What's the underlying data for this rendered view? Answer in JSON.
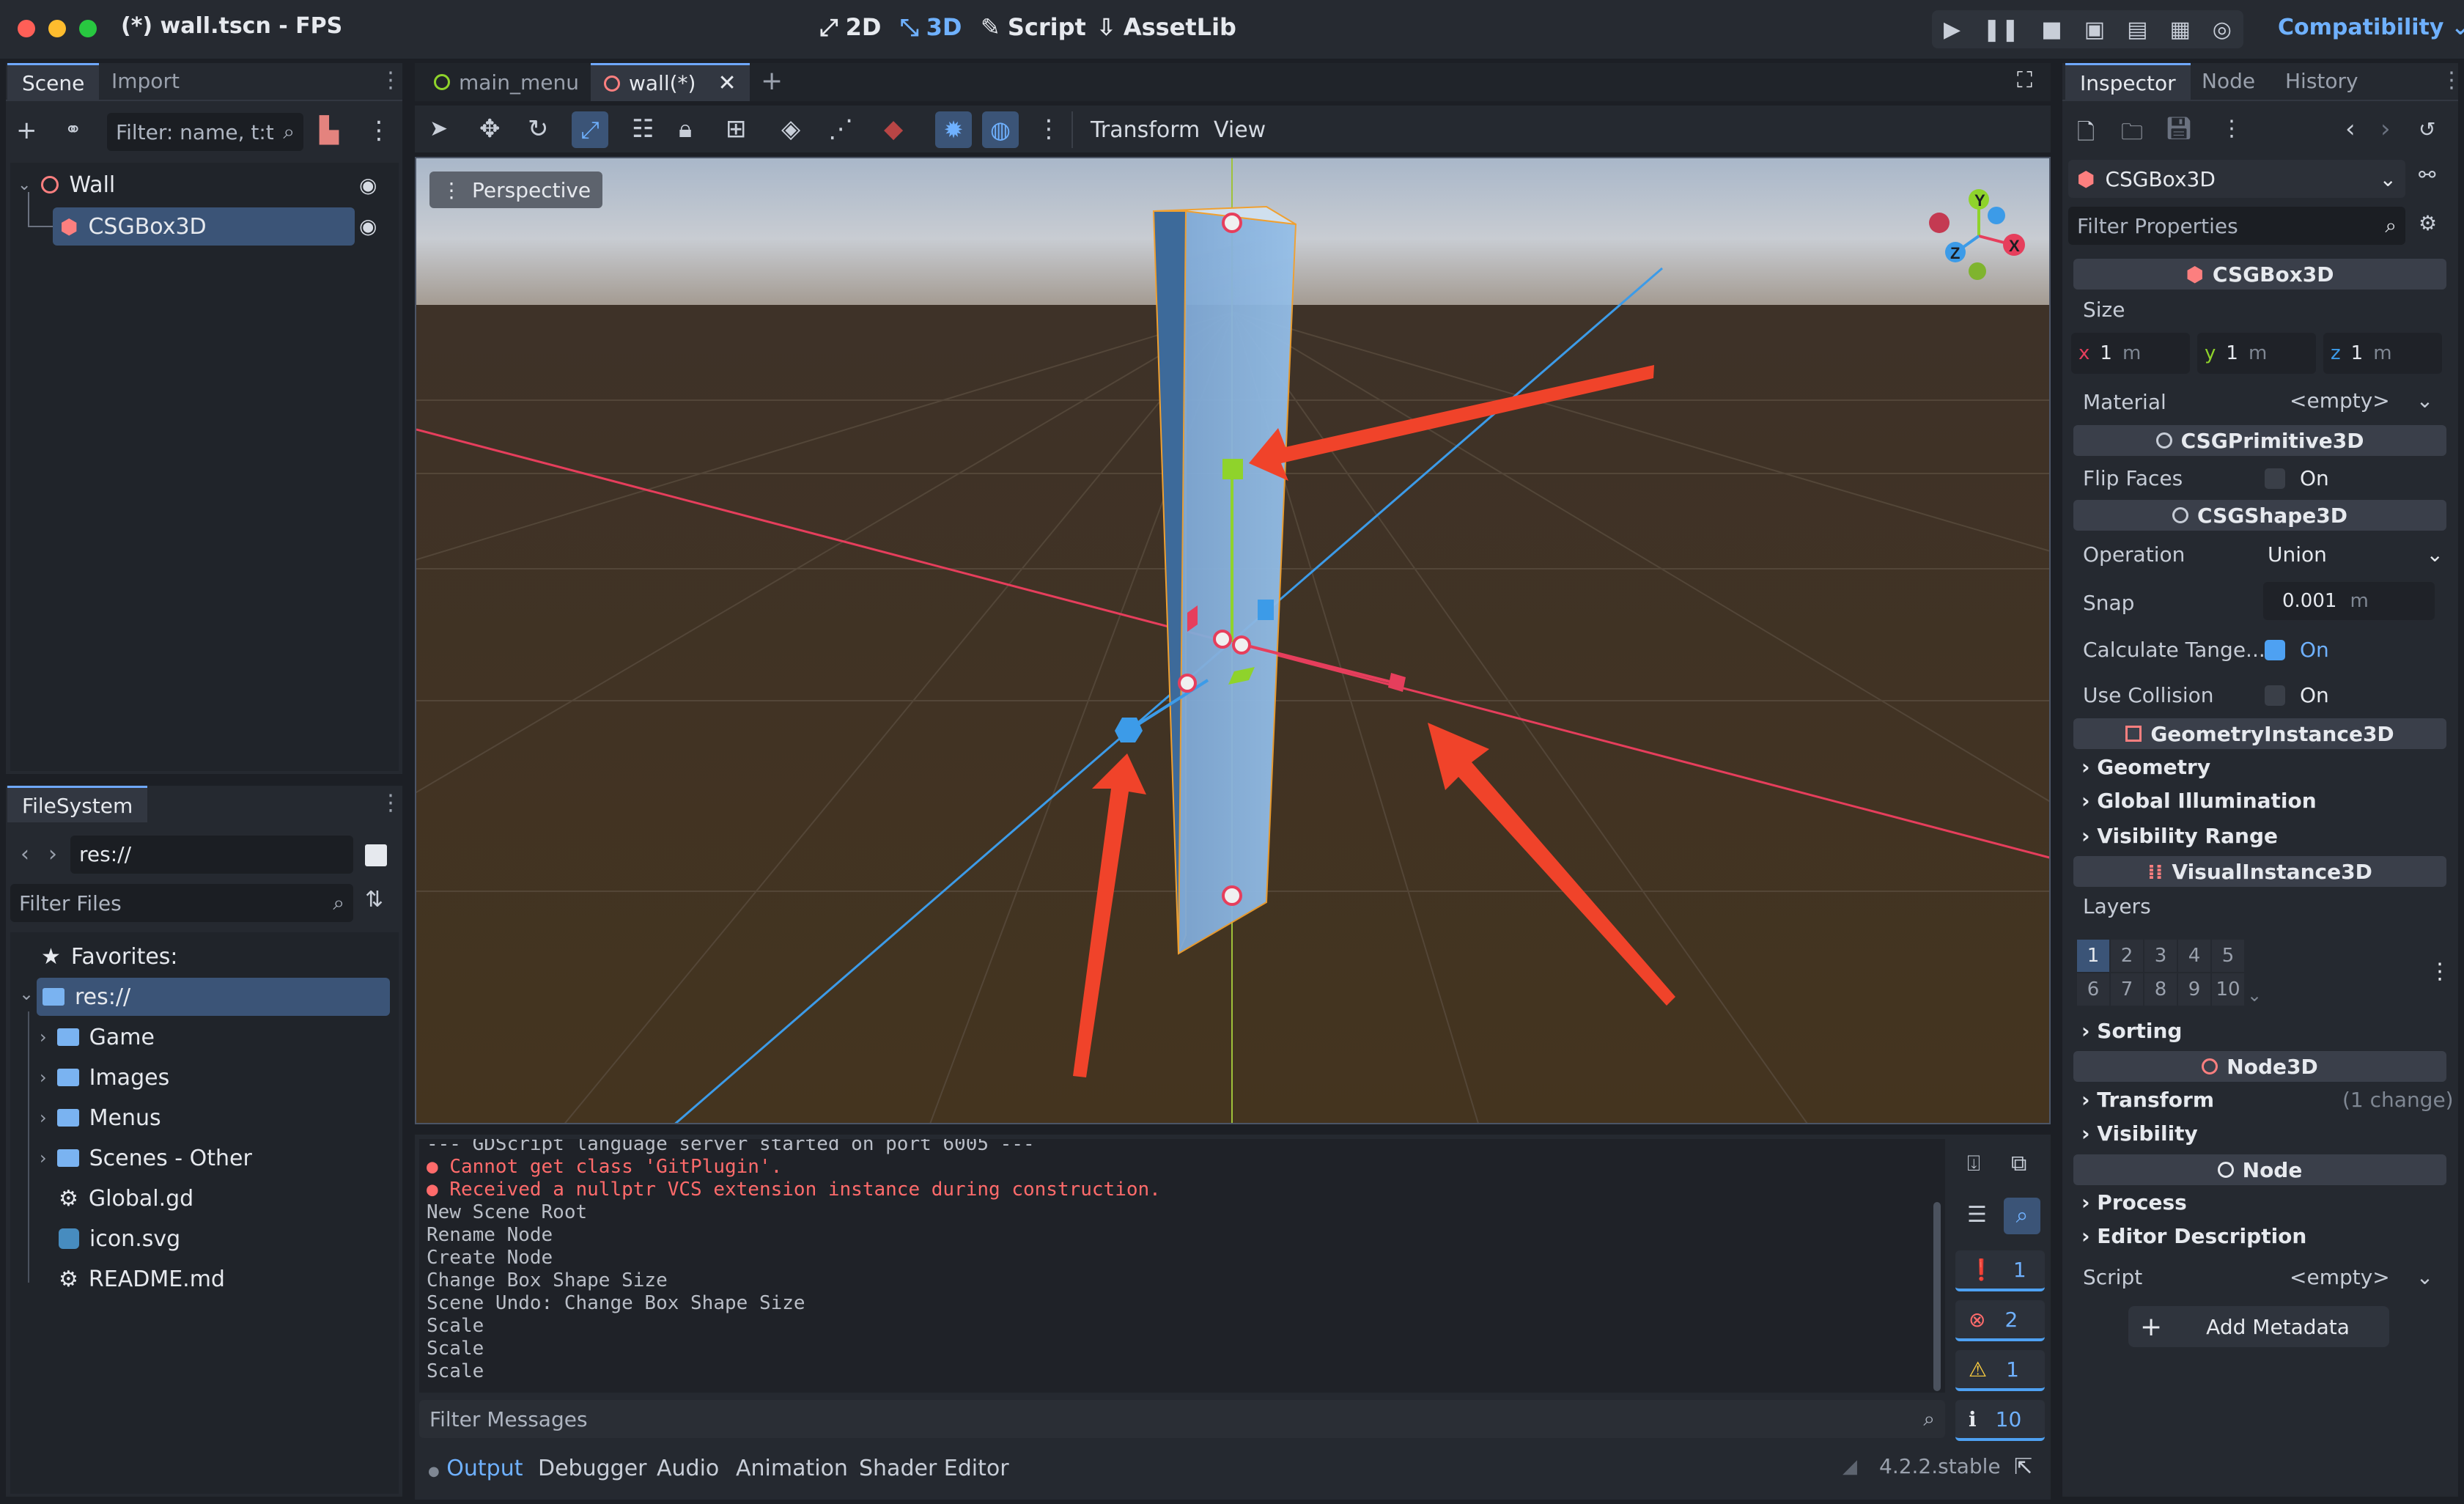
{
  "window": {
    "title": "(*) wall.tscn - FPS"
  },
  "main_modes": [
    "2D",
    "3D",
    "Script",
    "AssetLib"
  ],
  "renderer": "Compatibility",
  "scene_dock": {
    "tabs": [
      "Scene",
      "Import"
    ],
    "filter_placeholder": "Filter: name, t:t",
    "tree": [
      {
        "label": "Wall",
        "icon": "node3d-circle-icon"
      },
      {
        "label": "CSGBox3D",
        "icon": "csgbox-icon"
      }
    ]
  },
  "filesystem": {
    "tab": "FileSystem",
    "path": "res://",
    "filter_placeholder": "Filter Files",
    "items": [
      {
        "label": "Favorites:",
        "icon": "star-icon"
      },
      {
        "label": "res://",
        "icon": "folder-icon"
      },
      {
        "label": "Game",
        "icon": "folder-icon"
      },
      {
        "label": "Images",
        "icon": "folder-icon"
      },
      {
        "label": "Menus",
        "icon": "folder-icon"
      },
      {
        "label": "Scenes - Other",
        "icon": "folder-icon"
      },
      {
        "label": "Global.gd",
        "icon": "gear-icon"
      },
      {
        "label": "icon.svg",
        "icon": "image-icon"
      },
      {
        "label": "README.md",
        "icon": "gear-icon"
      }
    ]
  },
  "editor_tabs": [
    {
      "label": "main_menu",
      "active": false
    },
    {
      "label": "wall(*)",
      "active": true
    }
  ],
  "viewport_toolbar": {
    "transform": "Transform",
    "view": "View"
  },
  "viewport": {
    "perspective_label": "Perspective",
    "gizmo_axes": [
      "Y",
      "X",
      "Z"
    ]
  },
  "console": {
    "lines": [
      {
        "text": "--- GDScript language server started on port 6005 ---",
        "type": "info"
      },
      {
        "text": "Cannot get class 'GitPlugin'.",
        "type": "error"
      },
      {
        "text": "Received a nullptr VCS extension instance during construction.",
        "type": "error"
      },
      {
        "text": "New Scene Root",
        "type": "info"
      },
      {
        "text": "Rename Node",
        "type": "info"
      },
      {
        "text": "Create Node",
        "type": "info"
      },
      {
        "text": "Change Box Shape Size",
        "type": "info"
      },
      {
        "text": "Scene Undo: Change Box Shape Size",
        "type": "info"
      },
      {
        "text": "Scale",
        "type": "info"
      },
      {
        "text": "Scale",
        "type": "info"
      },
      {
        "text": "Scale",
        "type": "info"
      }
    ],
    "filter_placeholder": "Filter Messages",
    "counts": {
      "messages": "1",
      "errors": "2",
      "warnings": "1",
      "editor": "10"
    }
  },
  "bottom_tabs": [
    "Output",
    "Debugger",
    "Audio",
    "Animation",
    "Shader Editor"
  ],
  "version": "4.2.2.stable",
  "inspector": {
    "tabs": [
      "Inspector",
      "Node",
      "History"
    ],
    "node_selector": "CSGBox3D",
    "filter_placeholder": "Filter Properties",
    "sections": {
      "csgbox": "CSGBox3D",
      "csgprimitive": "CSGPrimitive3D",
      "csgshape": "CSGShape3D",
      "geometry_instance": "GeometryInstance3D",
      "visual_instance": "VisualInstance3D",
      "node3d": "Node3D",
      "node": "Node"
    },
    "size_label": "Size",
    "size": {
      "x": "1",
      "y": "1",
      "z": "1",
      "unit": "m"
    },
    "material_label": "Material",
    "material_value": "<empty>",
    "flip_faces_label": "Flip Faces",
    "flip_faces_value": "On",
    "operation_label": "Operation",
    "operation_value": "Union",
    "snap_label": "Snap",
    "snap_value": "0.001",
    "snap_unit": "m",
    "calc_tangents_label": "Calculate Tange...",
    "calc_tangents_value": "On",
    "use_collision_label": "Use Collision",
    "use_collision_value": "On",
    "foldouts": {
      "geometry": "Geometry",
      "gi": "Global Illumination",
      "visibility_range": "Visibility Range",
      "sorting": "Sorting",
      "transform": "Transform",
      "transform_note": "(1 change)",
      "visibility": "Visibility",
      "process": "Process",
      "editor_description": "Editor Description"
    },
    "layers_label": "Layers",
    "layers": [
      "1",
      "2",
      "3",
      "4",
      "5",
      "6",
      "7",
      "8",
      "9",
      "10"
    ],
    "script_label": "Script",
    "script_value": "<empty>",
    "add_metadata": "Add Metadata"
  },
  "colors": {
    "accent": "#6fb1ff",
    "error": "#ff6b6b",
    "x_axis": "#e63e5c",
    "y_axis": "#8fd32b",
    "z_axis": "#3c9be8",
    "arrow": "#f0432a"
  }
}
